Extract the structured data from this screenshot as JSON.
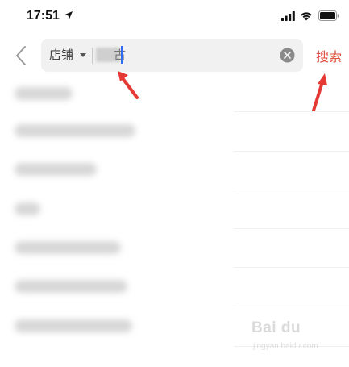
{
  "status_bar": {
    "time": "17:51",
    "icons": [
      "location-arrow-icon",
      "signal-icon",
      "wifi-icon",
      "battery-icon"
    ]
  },
  "header": {
    "back_icon": "chevron-left-icon",
    "scope_label": "店铺",
    "scope_caret_icon": "caret-down-icon",
    "search_text_visible_end": "古",
    "clear_icon": "clear-circle-icon",
    "search_button": "搜索"
  },
  "history": {
    "items_blurred": 7
  },
  "annotations": {
    "arrow_color": "#e53935"
  },
  "watermark": {
    "brand": "Bai du",
    "url": "jingyan.baidu.com"
  },
  "colors": {
    "accent": "#e04a3a",
    "cursor": "#2f6df6",
    "search_bg": "#f1f1f1"
  }
}
